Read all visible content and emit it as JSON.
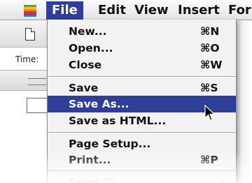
{
  "menubar": {
    "apple_icon": "apple-icon",
    "menus": [
      "File",
      "Edit",
      "View",
      "Insert",
      "Forr"
    ],
    "active_menu": "File"
  },
  "window": {
    "time_label": "Time:"
  },
  "file_menu": {
    "items": [
      {
        "label": "New...",
        "shortcut": "⌘N"
      },
      {
        "label": "Open...",
        "shortcut": "⌘O"
      },
      {
        "label": "Close",
        "shortcut": "⌘W"
      },
      {
        "label": "Save",
        "shortcut": "⌘S"
      },
      {
        "label": "Save As...",
        "shortcut": ""
      },
      {
        "label": "Save as HTML...",
        "shortcut": ""
      },
      {
        "label": "Page Setup...",
        "shortcut": ""
      },
      {
        "label": "Print...",
        "shortcut": "⌘P"
      },
      {
        "label": "Send To",
        "shortcut": ""
      }
    ],
    "highlighted": "Save As...",
    "accent_color": "#2f3f99"
  },
  "cursor": "arrow-cursor-icon"
}
